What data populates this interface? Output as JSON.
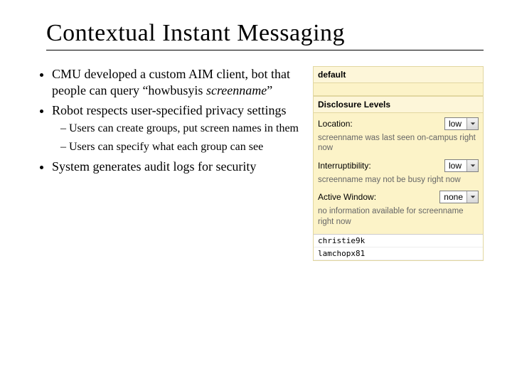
{
  "title": "Contextual Instant Messaging",
  "bullets": {
    "b1_a": "CMU developed a custom AIM client, bot that people can query “howbusyis ",
    "b1_b": "screenname",
    "b1_c": "”",
    "b2": "Robot respects user-specified privacy settings",
    "b2_1": "Users can create groups, put screen names in them",
    "b2_2": "Users can specify what each group can see",
    "b3": "System generates audit logs for security"
  },
  "panel": {
    "group_header": "default",
    "section_header": "Disclosure Levels",
    "location_label": "Location:",
    "location_value": "low",
    "location_note": "screenname was last seen on-campus right now",
    "interrupt_label": "Interruptibility:",
    "interrupt_value": "low",
    "interrupt_note": "screenname may not be busy right now",
    "active_label": "Active Window:",
    "active_value": "none",
    "active_note": "no information available for screenname right now",
    "buddies": {
      "0": "christie9k",
      "1": "lamchopx81"
    }
  }
}
